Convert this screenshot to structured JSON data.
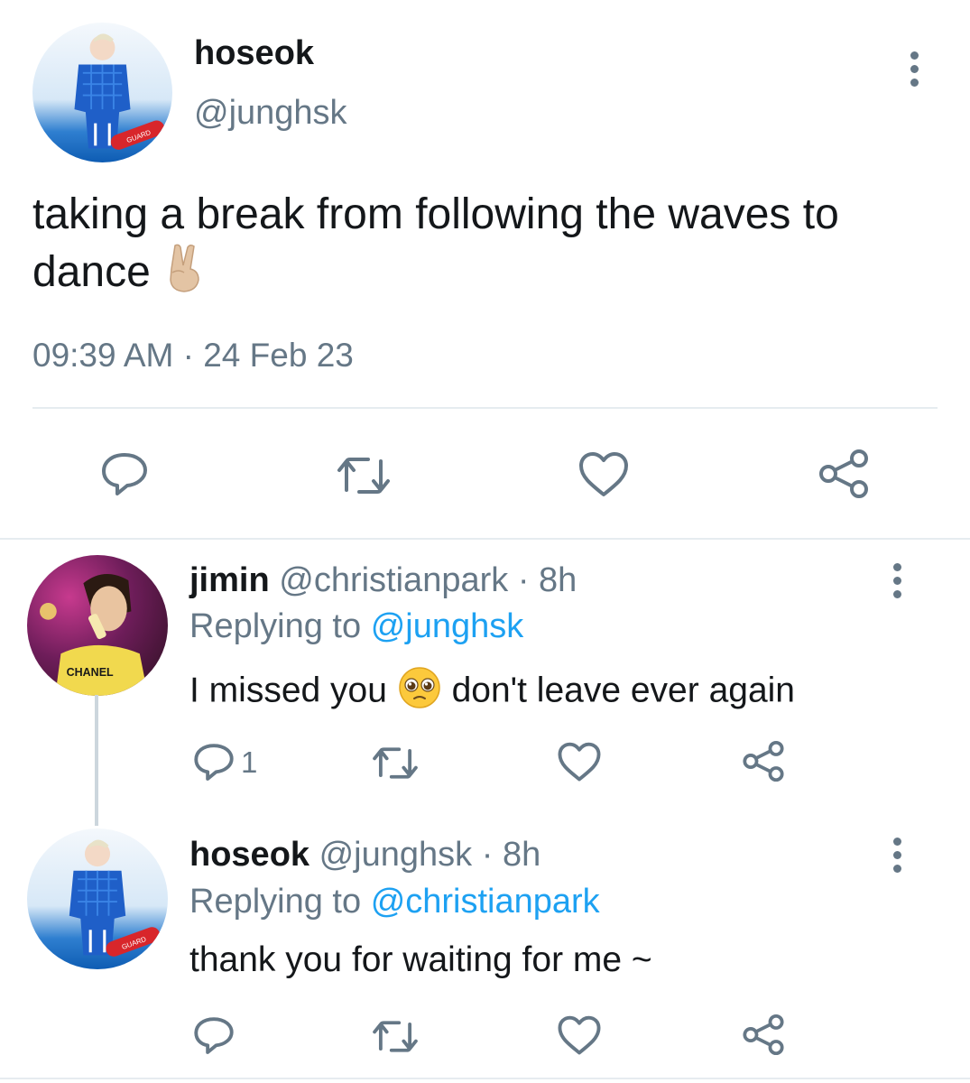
{
  "tweet": {
    "display_name": "hoseok",
    "handle": "@junghsk",
    "text": "taking a break from following the waves to dance",
    "emoji": "victory-hand",
    "time": "09:39 AM",
    "separator": "·",
    "date": "24 Feb 23",
    "avatar_text": "GUARD"
  },
  "replies": [
    {
      "display_name": "jimin",
      "handle": "@christianpark",
      "dot": "·",
      "age": "8h",
      "replying_prefix": "Replying to",
      "replying_to": "@junghsk",
      "text_before": "I missed you",
      "emoji": "pleading-face",
      "text_after": "don't leave ever again",
      "reply_count": "1",
      "avatar_text": "CHANEL"
    },
    {
      "display_name": "hoseok",
      "handle": "@junghsk",
      "dot": "·",
      "age": "8h",
      "replying_prefix": "Replying to",
      "replying_to": "@christianpark",
      "text": "thank you for waiting for me ~",
      "avatar_text": "GUARD"
    }
  ],
  "colors": {
    "text": "#14171a",
    "secondary": "#657786",
    "link": "#1da1f2",
    "divider": "#e6ecf0",
    "icon": "#657786"
  },
  "icons": [
    "reply-icon",
    "retweet-icon",
    "like-icon",
    "share-icon",
    "more-icon"
  ]
}
